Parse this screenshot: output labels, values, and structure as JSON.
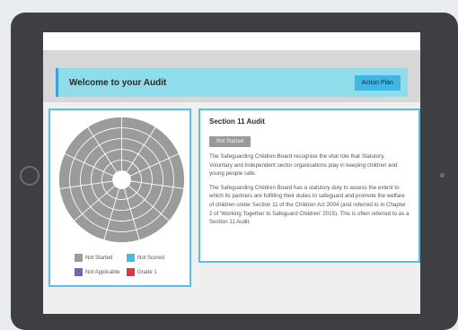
{
  "header": {
    "title": "Welcome to your Audit",
    "action_label": "Action Plan"
  },
  "info": {
    "title": "Section 11 Audit",
    "status": "Not Started",
    "paragraphs": [
      "The Safeguarding Children Board recognise the vital role that Statutory, Voluntary and Independent sector organisations play in keeping children and young people safe.",
      "The Safeguarding Children Board has a statutory duty to assess the extent to which its partners are fulfilling their duties to safeguard and promote the welfare of children under Section 11 of the Children Act 2004 (and referred to in Chapter 2 of 'Working Together to Safeguard Children' 2015). This is often referred to as a Section 11 Audit."
    ]
  },
  "legend": [
    {
      "label": "Not Started",
      "color": "#9a9c9b"
    },
    {
      "label": "Not Scored",
      "color": "#4bb9e6"
    },
    {
      "label": "Not Applicable",
      "color": "#7b5fb0"
    },
    {
      "label": "Grade 1",
      "color": "#e6353f"
    }
  ],
  "wheel": {
    "segments": 11,
    "rings": 5,
    "fill": "#9a9c9b",
    "line_color": "#ffffff"
  },
  "colors": {
    "accent": "#42b6e3",
    "header_bg": "#8fdcea",
    "panel_border": "#5bbce8"
  }
}
